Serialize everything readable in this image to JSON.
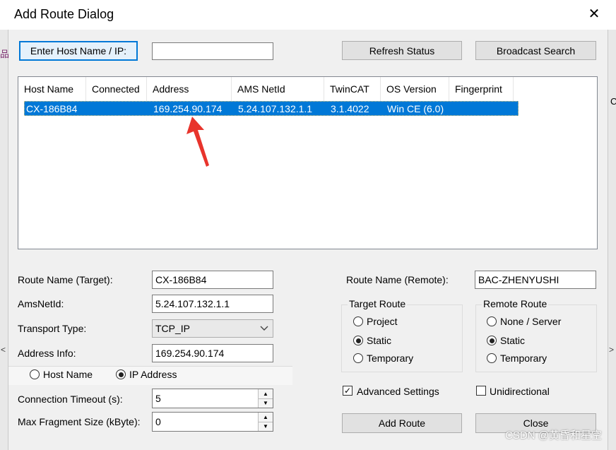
{
  "window": {
    "title": "Add Route Dialog",
    "close_glyph": "✕"
  },
  "background": {
    "left_glyph": "品",
    "right_glyph": "C",
    "left_arrow": "<",
    "right_arrow": ">"
  },
  "toolbar": {
    "enter_host_label": "Enter Host Name / IP:",
    "host_value": "",
    "refresh_label": "Refresh Status",
    "broadcast_label": "Broadcast Search"
  },
  "list": {
    "columns": [
      "Host Name",
      "Connected",
      "Address",
      "AMS NetId",
      "TwinCAT",
      "OS Version",
      "Fingerprint"
    ],
    "rows": [
      [
        "CX-186B84",
        "",
        "169.254.90.174",
        "5.24.107.132.1.1",
        "3.1.4022",
        "Win CE (6.0)",
        ""
      ]
    ]
  },
  "form": {
    "route_name_target_label": "Route Name (Target):",
    "route_name_target_value": "CX-186B84",
    "ams_netid_label": "AmsNetId:",
    "ams_netid_value": "5.24.107.132.1.1",
    "transport_label": "Transport Type:",
    "transport_value": "TCP_IP",
    "address_info_label": "Address Info:",
    "address_info_value": "169.254.90.174",
    "host_name_radio": "Host Name",
    "ip_address_radio": "IP Address",
    "timeout_label": "Connection Timeout (s):",
    "timeout_value": "5",
    "fragment_label": "Max Fragment Size (kByte):",
    "fragment_value": "0",
    "route_name_remote_label": "Route Name (Remote):",
    "route_name_remote_value": "BAC-ZHENYUSHI"
  },
  "target_route": {
    "title": "Target Route",
    "options": [
      "Project",
      "Static",
      "Temporary"
    ],
    "selected": "Static"
  },
  "remote_route": {
    "title": "Remote Route",
    "options": [
      "None / Server",
      "Static",
      "Temporary"
    ],
    "selected": "Static"
  },
  "checks": {
    "advanced_label": "Advanced Settings",
    "advanced_checked": true,
    "unidirectional_label": "Unidirectional",
    "unidirectional_checked": false
  },
  "buttons": {
    "add_route": "Add Route",
    "close": "Close"
  },
  "watermark": "CSDN @黄昏和星空",
  "colors": {
    "selection": "#0078d7",
    "arrow": "#e8342c"
  },
  "icons": {
    "dropdown": "chevron-down-icon",
    "spin_up": "▲",
    "spin_down": "▼"
  }
}
